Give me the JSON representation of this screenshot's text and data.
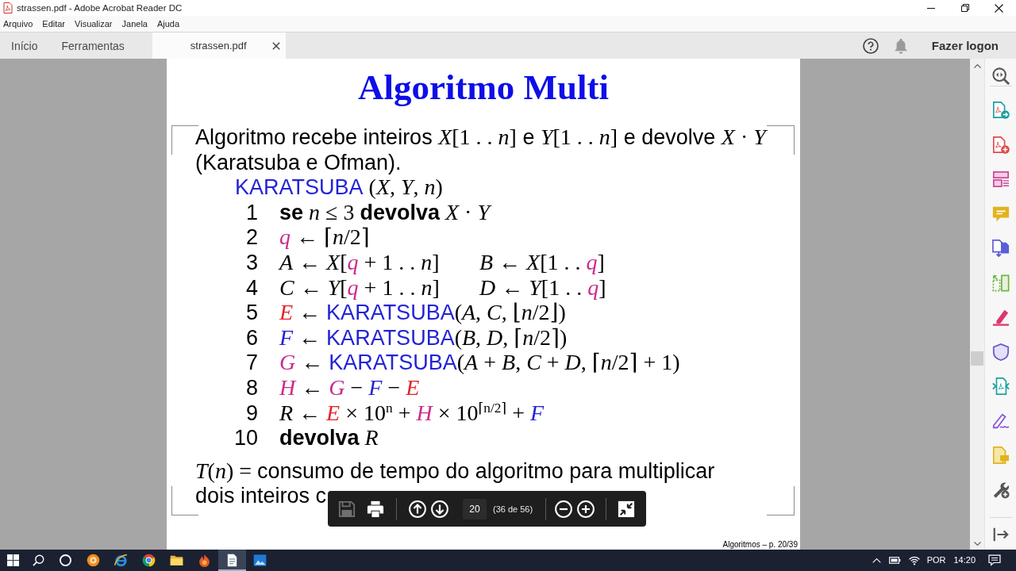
{
  "window": {
    "title": "strassen.pdf - Adobe Acrobat Reader DC"
  },
  "menu": [
    "Arquivo",
    "Editar",
    "Visualizar",
    "Janela",
    "Ajuda"
  ],
  "tabs": [
    {
      "label": "Início",
      "selected": false,
      "closable": false
    },
    {
      "label": "Ferramentas",
      "selected": false,
      "closable": false
    },
    {
      "label": "strassen.pdf",
      "selected": true,
      "closable": true
    }
  ],
  "sign_in_button": "Fazer logon",
  "document_page": {
    "title": "Algoritmo Multi",
    "intro": [
      {
        "kind": "text",
        "text": "Algoritmo recebe inteiros "
      },
      {
        "kind": "math",
        "text": "*X*[1 . . *n*]"
      },
      {
        "kind": "text",
        "text": " e "
      },
      {
        "kind": "math",
        "text": "*Y*[1 . . *n*]"
      },
      {
        "kind": "text",
        "text": " e devolve "
      },
      {
        "kind": "math",
        "text": "*X* · *Y*"
      },
      {
        "kind": "text",
        "text": " (Karatsuba e Ofman)."
      }
    ],
    "procedure": {
      "header": [
        {
          "kind": "name",
          "text": "KARATSUBA",
          "color": "#2323d6"
        },
        {
          "kind": "math",
          "text": " (*X*, *Y*, *n*)"
        }
      ],
      "lines": [
        {
          "number": "1",
          "columns": [
            [
              {
                "kind": "bold",
                "text": "se"
              },
              {
                "kind": "math",
                "text": " *n* ≤ 3 "
              },
              {
                "kind": "bold",
                "text": "devolva"
              },
              {
                "kind": "math",
                "text": " *X* · *Y*"
              }
            ]
          ]
        },
        {
          "number": "2",
          "columns": [
            [
              {
                "kind": "math",
                "text": "*q*",
                "color": "#cc2a8c"
              },
              {
                "kind": "math",
                "text": " ← ⌈*n*/2⌉"
              }
            ]
          ]
        },
        {
          "number": "3",
          "columns": [
            [
              {
                "kind": "math",
                "text": "*A* ← *X*["
              },
              {
                "kind": "math",
                "text": "*q*",
                "color": "#cc2a8c"
              },
              {
                "kind": "math",
                "text": " + 1 . . *n*]"
              }
            ],
            [
              {
                "kind": "math",
                "text": "*B* ← *X*[1 . . "
              },
              {
                "kind": "math",
                "text": "*q*",
                "color": "#cc2a8c"
              },
              {
                "kind": "math",
                "text": "]"
              }
            ]
          ]
        },
        {
          "number": "4",
          "columns": [
            [
              {
                "kind": "math",
                "text": "*C* ← *Y*["
              },
              {
                "kind": "math",
                "text": "*q*",
                "color": "#cc2a8c"
              },
              {
                "kind": "math",
                "text": " + 1 . . *n*]"
              }
            ],
            [
              {
                "kind": "math",
                "text": "*D* ← *Y*[1 . . "
              },
              {
                "kind": "math",
                "text": "*q*",
                "color": "#cc2a8c"
              },
              {
                "kind": "math",
                "text": "]"
              }
            ]
          ]
        },
        {
          "number": "5",
          "columns": [
            [
              {
                "kind": "math",
                "text": "*E*",
                "color": "#e3242b"
              },
              {
                "kind": "math",
                "text": " ← "
              },
              {
                "kind": "name",
                "text": "KARATSUBA",
                "color": "#2323d6"
              },
              {
                "kind": "math",
                "text": "(*A*, *C*, ⌊*n*/2⌋)"
              }
            ]
          ]
        },
        {
          "number": "6",
          "columns": [
            [
              {
                "kind": "math",
                "text": "*F*",
                "color": "#2323d6"
              },
              {
                "kind": "math",
                "text": " ← "
              },
              {
                "kind": "name",
                "text": "KARATSUBA",
                "color": "#2323d6"
              },
              {
                "kind": "math",
                "text": "(*B*, *D*, ⌈*n*/2⌉)"
              }
            ]
          ]
        },
        {
          "number": "7",
          "columns": [
            [
              {
                "kind": "math",
                "text": "*G*",
                "color": "#cc2a8c"
              },
              {
                "kind": "math",
                "text": " ← "
              },
              {
                "kind": "name",
                "text": "KARATSUBA",
                "color": "#2323d6"
              },
              {
                "kind": "math",
                "text": "(*A* + *B*, *C* + *D*, ⌈*n*/2⌉ + 1)"
              }
            ]
          ]
        },
        {
          "number": "8",
          "columns": [
            [
              {
                "kind": "math",
                "text": "*H*",
                "color": "#cc2a8c"
              },
              {
                "kind": "math",
                "text": " ← "
              },
              {
                "kind": "math",
                "text": "*G*",
                "color": "#cc2a8c"
              },
              {
                "kind": "math",
                "text": " − "
              },
              {
                "kind": "math",
                "text": "*F*",
                "color": "#2323d6"
              },
              {
                "kind": "math",
                "text": " − "
              },
              {
                "kind": "math",
                "text": "*E*",
                "color": "#e3242b"
              }
            ]
          ]
        },
        {
          "number": "9",
          "columns": [
            [
              {
                "kind": "math",
                "text": "*R* ← "
              },
              {
                "kind": "math",
                "text": "*E*",
                "color": "#e3242b"
              },
              {
                "kind": "math",
                "text": " × 10$^{n}$ + "
              },
              {
                "kind": "math",
                "text": "*H*",
                "color": "#cc2a8c"
              },
              {
                "kind": "math",
                "text": " × 10$^{⌈n/2⌉}$ + "
              },
              {
                "kind": "math",
                "text": "*F*",
                "color": "#2323d6"
              }
            ]
          ]
        },
        {
          "number": "10",
          "columns": [
            [
              {
                "kind": "bold",
                "text": "devolva"
              },
              {
                "kind": "math",
                "text": " *R*"
              }
            ]
          ]
        }
      ]
    },
    "conclusion_lines": [
      [
        {
          "kind": "math",
          "text": "*T*(*n*) = "
        },
        {
          "kind": "text",
          "text": "consumo de tempo do algoritmo para multiplicar"
        }
      ],
      [
        {
          "kind": "text",
          "text": "dois inteiros c"
        }
      ]
    ],
    "footer": "Algoritmos – p. 20/39"
  },
  "floating_toolbar": {
    "file_buttons": [
      {
        "kind": "save",
        "disabled": true
      },
      {
        "kind": "print",
        "disabled": false
      }
    ],
    "nav_buttons": [
      {
        "kind": "up",
        "disabled": false
      },
      {
        "kind": "down",
        "disabled": false
      }
    ],
    "page_number": "20",
    "page_count": "(36 de 56)",
    "zoom_buttons": [
      {
        "kind": "minus",
        "disabled": false
      },
      {
        "kind": "plus",
        "disabled": false
      }
    ],
    "view_buttons": [
      {
        "kind": "fit",
        "disabled": false
      }
    ]
  },
  "taskbar": {
    "apps": [
      {
        "kind": "disc",
        "selected": false
      },
      {
        "kind": "ring",
        "selected": false
      },
      {
        "kind": "wheel",
        "selected": false
      },
      {
        "kind": "folder",
        "selected": false
      },
      {
        "kind": "flame",
        "selected": false
      },
      {
        "kind": "document",
        "selected": true
      },
      {
        "kind": "picture",
        "selected": false
      }
    ],
    "language": "POR",
    "time": "14:20"
  }
}
